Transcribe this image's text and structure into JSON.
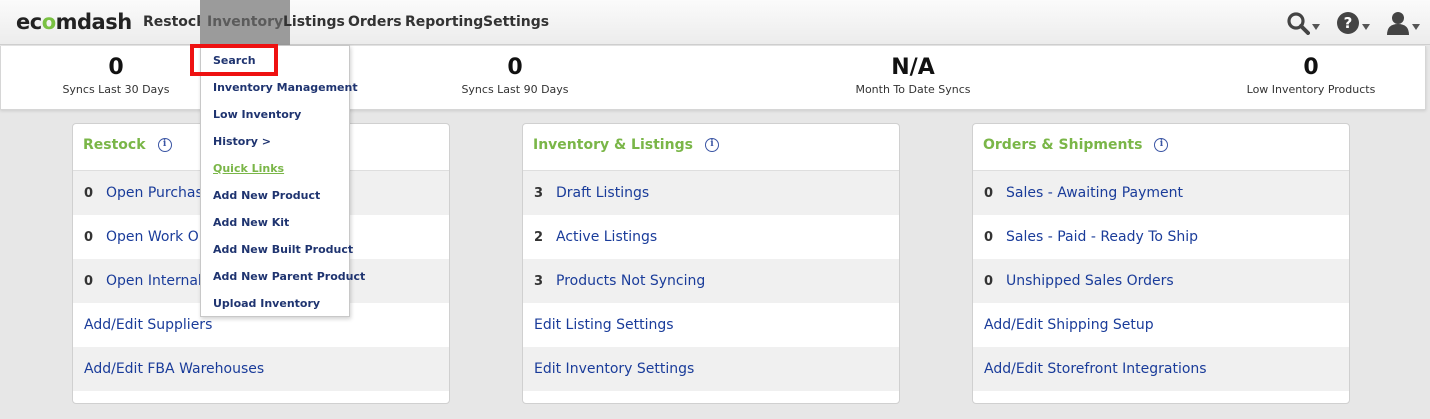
{
  "nav": {
    "logo_a": "ec",
    "logo_o": "o",
    "logo_b": "mdash",
    "items": [
      "Restock",
      "Inventory",
      "Listings",
      "Orders",
      "Reporting",
      "Settings"
    ],
    "active": "Inventory"
  },
  "tools": [
    "search-icon",
    "help-icon",
    "user-icon"
  ],
  "stats": [
    {
      "value": "0",
      "label": "Syncs Last 30 Days"
    },
    {
      "value": "0",
      "label": "Syncs Last 90 Days"
    },
    {
      "value": "N/A",
      "label": "Month To Date Syncs"
    },
    {
      "value": "0",
      "label": "Low Inventory Products"
    }
  ],
  "dropdown": {
    "items": [
      "Search",
      "Inventory Management",
      "Low Inventory",
      "History >",
      "Quick Links",
      "Add New Product",
      "Add New Kit",
      "Add New Built Product",
      "Add New Parent Product",
      "Upload Inventory"
    ]
  },
  "panels": [
    {
      "title": "Restock",
      "rows": [
        {
          "count": "0",
          "label": "Open Purchase Orders"
        },
        {
          "count": "0",
          "label": "Open Work Orders"
        },
        {
          "count": "0",
          "label": "Open Internal Transfers"
        },
        {
          "count": "",
          "label": "Add/Edit Suppliers"
        },
        {
          "count": "",
          "label": "Add/Edit FBA Warehouses"
        }
      ]
    },
    {
      "title": "Inventory & Listings",
      "rows": [
        {
          "count": "3",
          "label": "Draft Listings"
        },
        {
          "count": "2",
          "label": "Active Listings"
        },
        {
          "count": "3",
          "label": "Products Not Syncing"
        },
        {
          "count": "",
          "label": "Edit Listing Settings"
        },
        {
          "count": "",
          "label": "Edit Inventory Settings"
        }
      ]
    },
    {
      "title": "Orders & Shipments",
      "rows": [
        {
          "count": "0",
          "label": "Sales - Awaiting Payment"
        },
        {
          "count": "0",
          "label": "Sales - Paid - Ready To Ship"
        },
        {
          "count": "0",
          "label": "Unshipped Sales Orders"
        },
        {
          "count": "",
          "label": "Add/Edit Shipping Setup"
        },
        {
          "count": "",
          "label": "Add/Edit Storefront Integrations"
        }
      ]
    }
  ],
  "colors": {
    "brand_green": "#7ab648",
    "link_blue": "#1a3c9a",
    "highlight_red": "#ee1111"
  }
}
